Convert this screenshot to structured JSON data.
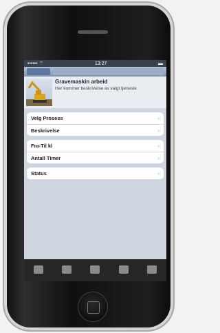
{
  "status": {
    "left": "•••••• ⌔",
    "time": "13:27",
    "right": "▬"
  },
  "topbar": {
    "back_label": "",
    "segment_label": ""
  },
  "header": {
    "title": "Gravemaskin arbeid",
    "subtitle": "Her kommer beskrivelse av valgt tjeneste"
  },
  "groups": [
    {
      "rows": [
        {
          "label": "Velg Prosess"
        },
        {
          "label": "Beskrivelse"
        }
      ]
    },
    {
      "rows": [
        {
          "label": "Fra-Til kl"
        },
        {
          "label": "Antall Timer"
        }
      ]
    },
    {
      "rows": [
        {
          "label": "Status"
        }
      ]
    }
  ],
  "tabs": [
    {
      "label": ""
    },
    {
      "label": ""
    },
    {
      "label": ""
    },
    {
      "label": ""
    },
    {
      "label": ""
    }
  ],
  "colors": {
    "statusbar": "#3a4250",
    "topbar": "#8fa2c0",
    "tabbar": "#262626"
  }
}
